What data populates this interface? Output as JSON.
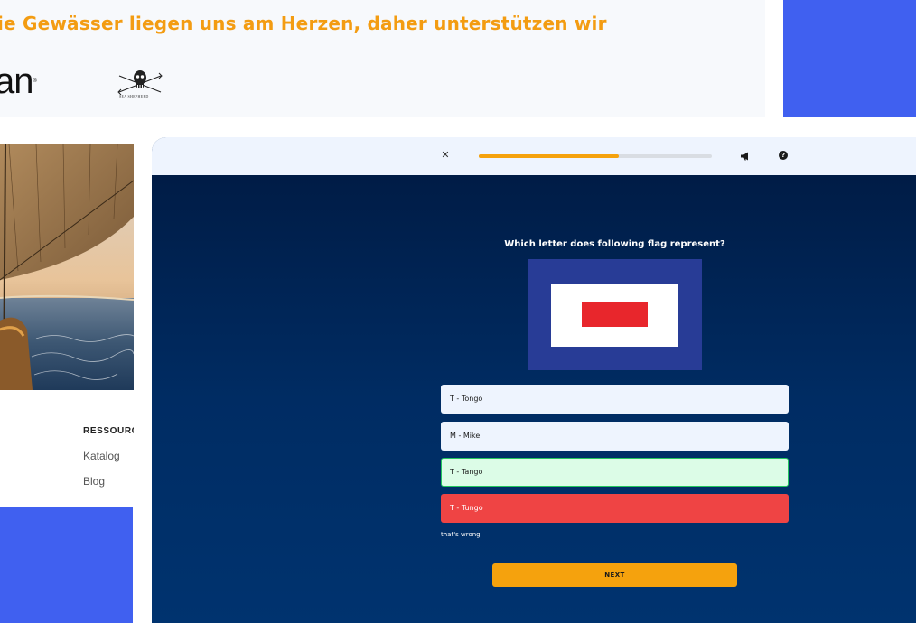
{
  "website": {
    "headline": "ie Gewässer liegen uns am Herzen, daher unterstützen wir",
    "partner_logo_text": "an",
    "seal_caption": "SEA SHEPHERD",
    "resources": {
      "heading": "RESSOURC",
      "links": [
        "Katalog",
        "Blog"
      ]
    }
  },
  "quiz": {
    "progress_fraction": 0.6,
    "question": "Which letter does following flag represent?",
    "flag_colors": {
      "outer": "#283c96",
      "middle": "#ffffff",
      "center": "#e8262c"
    },
    "options": [
      {
        "label": "T - Tongo",
        "state": "default"
      },
      {
        "label": "M - Mike",
        "state": "default"
      },
      {
        "label": "T - Tango",
        "state": "correct"
      },
      {
        "label": "T - Tungo",
        "state": "wrong"
      }
    ],
    "feedback": "that's wrong",
    "next_label": "NEXT"
  },
  "colors": {
    "accent_orange": "#f5a20d",
    "brand_blue": "#4060f0",
    "quiz_navy": "#002c66",
    "correct_green": "#22c55e",
    "wrong_red": "#ef4444"
  },
  "icons": {
    "close": "✕",
    "megaphone": "megaphone-icon",
    "help": "?"
  }
}
